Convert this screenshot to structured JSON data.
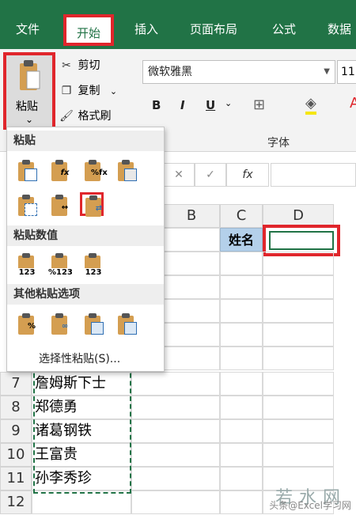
{
  "ribbon_tabs": [
    "文件",
    "开始",
    "插入",
    "页面布局",
    "公式",
    "数据"
  ],
  "clipboard": {
    "paste_label": "粘贴",
    "cut_label": "剪切",
    "copy_label": "复制",
    "format_painter_label": "格式刷"
  },
  "font": {
    "name": "微软雅黑",
    "size": "11",
    "group_label": "字体",
    "bold": "B",
    "italic": "I",
    "underline": "U"
  },
  "paste_menu": {
    "section_paste": "粘贴",
    "section_values": "粘贴数值",
    "section_other": "其他粘贴选项",
    "special": "选择性粘贴(S)..."
  },
  "formula_bar": {
    "fx": "fx"
  },
  "columns": [
    "B",
    "C",
    "D"
  ],
  "rows": [
    "7",
    "8",
    "9",
    "10",
    "11",
    "12"
  ],
  "names": [
    "詹姆斯下士",
    "郑德勇",
    "诸葛钢铁",
    "王富贵",
    "孙李秀珍",
    ""
  ],
  "header_cell": "姓名",
  "watermark": "头条@Excel学习网",
  "colors": {
    "ribbon_green": "#217346",
    "highlight_red": "#e0262c"
  }
}
